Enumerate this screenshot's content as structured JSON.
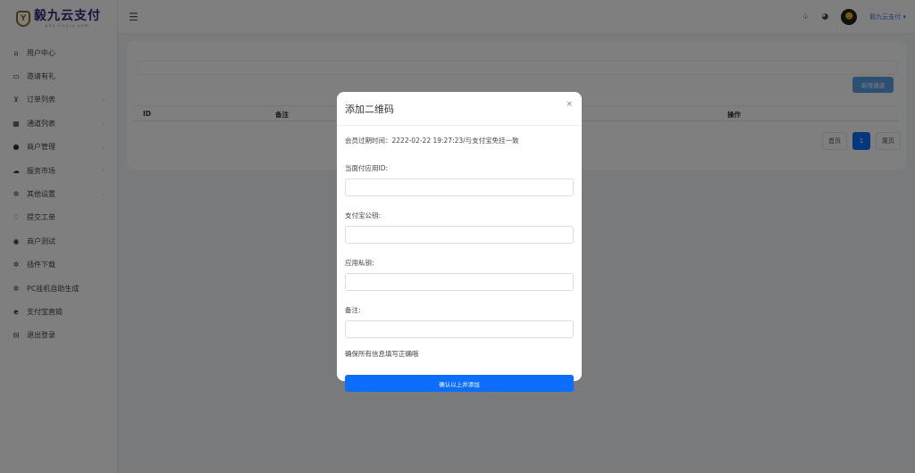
{
  "app": {
    "logo_mark": "Y",
    "logo_title": "毅九云支付",
    "logo_sub": "pay.liuyiu.com",
    "user_name": "毅九云支付 ▾"
  },
  "sidebar": {
    "items": [
      {
        "label": "用户中心",
        "icon": "home-icon"
      },
      {
        "label": "邀请有礼",
        "icon": "message-icon"
      },
      {
        "label": "订单列表",
        "icon": "cart-icon"
      },
      {
        "label": "通道列表",
        "icon": "qrcode-icon"
      },
      {
        "label": "商户管理",
        "icon": "user-icon"
      },
      {
        "label": "服务市场",
        "icon": "cloud-icon"
      },
      {
        "label": "其他设置",
        "icon": "gear-icon"
      },
      {
        "label": "提交工单",
        "icon": "chat-icon"
      },
      {
        "label": "商户测试",
        "icon": "compass-icon"
      },
      {
        "label": "插件下载",
        "icon": "gear-icon"
      },
      {
        "label": "PC挂机自助生成",
        "icon": "gear-icon"
      },
      {
        "label": "支付宝直链",
        "icon": "alipay-icon"
      },
      {
        "label": "退出登录",
        "icon": "logout-icon"
      }
    ]
  },
  "main": {
    "new_button": "新增通道",
    "columns": [
      "ID",
      "备注",
      "操作"
    ],
    "pager": {
      "first": "首页",
      "current": "1",
      "last": "尾页"
    }
  },
  "modal": {
    "title": "添加二维码",
    "close": "×",
    "notice": "会员过期时间：2222-02-22 19:27:23/与支付宝免挂一致",
    "fields": [
      {
        "label": "当面付应用ID:",
        "value": ""
      },
      {
        "label": "支付宝公钥:",
        "value": ""
      },
      {
        "label": "应用私钥:",
        "value": ""
      },
      {
        "label": "备注:",
        "value": ""
      }
    ],
    "confirm_note": "确保所有信息填写正确哦",
    "submit": "确认以上并添加"
  },
  "colors": {
    "primary": "#0d6efd",
    "overlay": "rgba(0,0,0,0.5)",
    "brand": "#2a2a7a"
  }
}
